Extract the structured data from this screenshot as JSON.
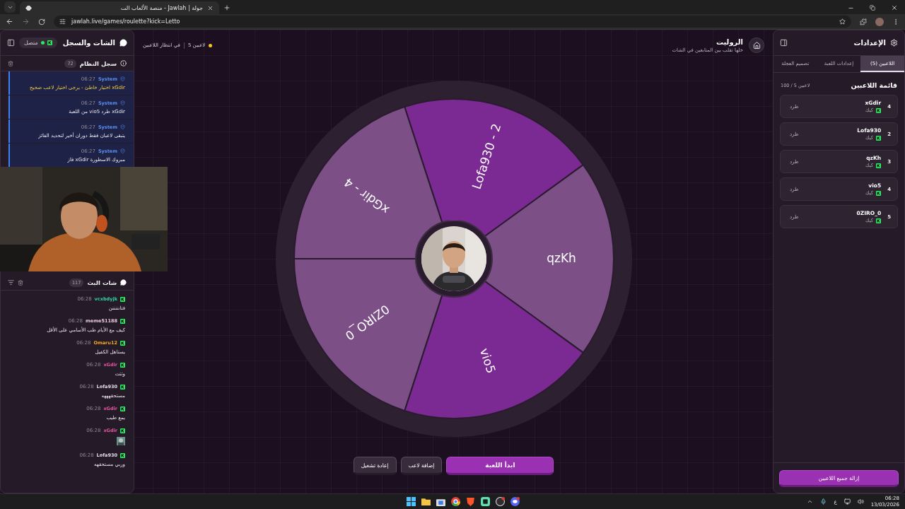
{
  "browser": {
    "tab_title": "جولة | Jawlah - منصة الألعاب الت",
    "url": "jawlah.live/games/roulette?kick=Letto"
  },
  "chat_panel": {
    "title": "الشات والسجل",
    "status": "متصل",
    "system_log": {
      "title": "سجل النظام",
      "count": "72",
      "entries": [
        {
          "author": "System",
          "time": "06:27",
          "text": "xGdir اختيار خاطئ - يرجى اختيار لاعب صحيح",
          "kind": "warning"
        },
        {
          "author": "System",
          "time": "06:27",
          "text": "xGdir طرد vio5 من اللعبة",
          "kind": "info"
        },
        {
          "author": "System",
          "time": "06:27",
          "text": "يتبقى لاعبان فقط دوران أخير لتحديد الفائز",
          "kind": "info"
        },
        {
          "author": "System",
          "time": "06:27",
          "text": "مبروك الاسطورة xGdir فاز",
          "kind": "info"
        }
      ]
    },
    "stream_chat": {
      "title": "شات البث",
      "count": "117",
      "messages": [
        {
          "user": "vcxbdyjk",
          "color": "#2fd3a6",
          "time": "06:28",
          "text": "فتانننننن",
          "kind": "text"
        },
        {
          "user": "meme51188",
          "color": "#e8c9dc",
          "time": "06:28",
          "text": "كيف مع الأيام طب الأسامي على الأقل",
          "kind": "text"
        },
        {
          "user": "Omaru12",
          "color": "#f5a623",
          "time": "06:28",
          "text": "يستاهل الكفيل",
          "kind": "text"
        },
        {
          "user": "xGdir",
          "color": "#e0559c",
          "time": "06:28",
          "text": "وتتت",
          "kind": "text"
        },
        {
          "user": "Lofa930",
          "color": "#e4dbe8",
          "time": "06:28",
          "text": "مستحقهههه",
          "kind": "text"
        },
        {
          "user": "xGdir",
          "color": "#e0559c",
          "time": "06:28",
          "text": "يمع طيب",
          "kind": "text"
        },
        {
          "user": "xGdir",
          "color": "#e0559c",
          "time": "06:28",
          "kind": "emote"
        },
        {
          "user": "Lofa930",
          "color": "#e4dbe8",
          "time": "06:28",
          "text": "وربي مستحقهه",
          "kind": "text"
        }
      ]
    }
  },
  "header": {
    "title": "الروليت",
    "subtitle": "خلها تقلب بين المتابعين في الشات",
    "player_count": "5 لاعبين",
    "status": "في انتظار اللاعبين"
  },
  "wheel": {
    "segments": [
      {
        "label": "Lofa930 - 2",
        "color": "#7b2993"
      },
      {
        "label": "qzKh",
        "color": "#7c4f87"
      },
      {
        "label": "vio5",
        "color": "#7b2993"
      },
      {
        "label": "0ZIRO_0",
        "color": "#7c4f87"
      },
      {
        "label": "xGdir - 4",
        "color": "#7c4f87"
      }
    ]
  },
  "actions": [
    {
      "label": "ابدأ اللعبة",
      "kind": "primary"
    },
    {
      "label": "إضافة لاعب",
      "kind": "secondary"
    },
    {
      "label": "إعادة تشغيل",
      "kind": "secondary"
    }
  ],
  "settings_panel": {
    "title": "الإعدادات",
    "tabs": [
      {
        "label": "اللاعبين (5)",
        "selected": true
      },
      {
        "label": "إعدادات اللعبة",
        "selected": false
      },
      {
        "label": "تصميم العجلة",
        "selected": false
      }
    ],
    "list_title": "قائمة اللاعبين",
    "capacity": "100 / 5 لاعبين",
    "players": [
      {
        "number": "4",
        "name": "xGdir",
        "platform": "كيك",
        "action": "طرد"
      },
      {
        "number": "2",
        "name": "Lofa930",
        "platform": "كيك",
        "action": "طرد"
      },
      {
        "number": "3",
        "name": "qzKh",
        "platform": "كيك",
        "action": "طرد"
      },
      {
        "number": "4",
        "name": "vio5",
        "platform": "كيك",
        "action": "طرد"
      },
      {
        "number": "5",
        "name": "0ZIRO_0",
        "platform": "كيك",
        "action": "طرد"
      }
    ],
    "clear_button": "إزالة جميع اللاعبين"
  },
  "taskbar": {
    "language": "ع",
    "time": "06:28",
    "date": "13/03/2026"
  }
}
